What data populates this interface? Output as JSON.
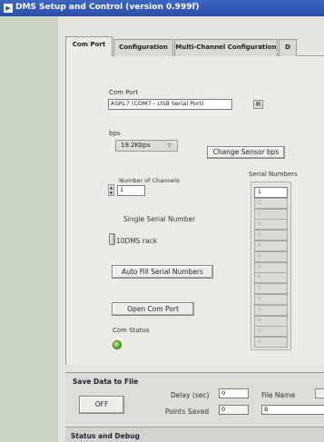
{
  "window": {
    "title": "DMS Setup and Control (version 0.999f)"
  },
  "tabs": [
    {
      "label": "Com Port"
    },
    {
      "label": "Configuration"
    },
    {
      "label": "Multi-Channel Configuration"
    },
    {
      "label": "D"
    }
  ],
  "com_port": {
    "label": "Com Port",
    "value": "ASRL7 (COM7 - USB Serial Port)",
    "bps_label": "bps",
    "bps_value": "19.2Kbps",
    "change_bps_button": "Change Sensor bps",
    "channels_label": "Number of Channels",
    "channels_value": "1",
    "serial_mode_label": "Single Serial Number",
    "rack_label": "10DMS rack",
    "auto_fill_button": "Auto Fill Serial Numbers",
    "open_button": "Open Com Port",
    "status_label": "Com Status",
    "serial_numbers_label": "Serial Numbers",
    "serial_numbers": [
      "1",
      "0",
      "0",
      "0",
      "0",
      "0",
      "0",
      "0",
      "0",
      "0",
      "0",
      "0",
      "0",
      "0",
      "0"
    ]
  },
  "save": {
    "title": "Save Data to File",
    "off_button": "OFF",
    "delay_label": "Delay (sec)",
    "delay_value": "0",
    "points_label": "Points Saved",
    "points_value": "0",
    "file_label": "File Name",
    "file_value": "B"
  },
  "status": {
    "title": "Status and Debug"
  },
  "colors": {
    "title_bar": "#2b4fa8",
    "led_green": "#4cb323"
  }
}
